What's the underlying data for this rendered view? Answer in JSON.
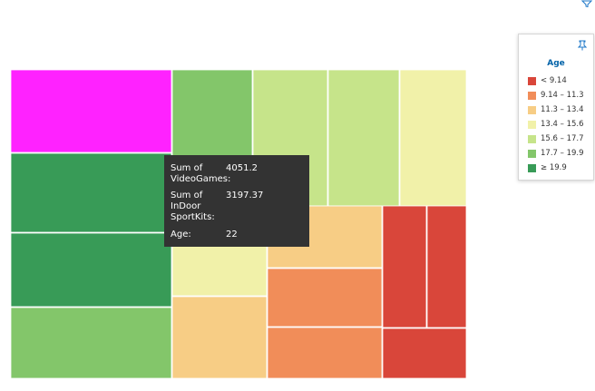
{
  "chart_data": {
    "type": "treemap",
    "legend": {
      "title": "Age",
      "placement": "top-right",
      "items": [
        {
          "label": "< 9.14",
          "color": "#d9463a"
        },
        {
          "label": "9.14 – 11.3",
          "color": "#f18d59"
        },
        {
          "label": "11.3 – 13.4",
          "color": "#f7cd85"
        },
        {
          "label": "13.4 – 15.6",
          "color": "#f1f1a9"
        },
        {
          "label": "15.6 – 17.7",
          "color": "#c6e48a"
        },
        {
          "label": "17.7 – 19.9",
          "color": "#83c66a"
        },
        {
          "label": "≥ 19.9",
          "color": "#389b57"
        }
      ]
    },
    "tooltip": {
      "rows": [
        {
          "key": "Sum of\nVideoGames:",
          "value": "4051.2"
        },
        {
          "key": "Sum of\nInDoor\nSportKits:",
          "value": "3197.37"
        },
        {
          "key": "Age:",
          "value": "22"
        }
      ]
    },
    "tile_color_scale": {
      "unhighlighted": "#ff22ff"
    }
  }
}
